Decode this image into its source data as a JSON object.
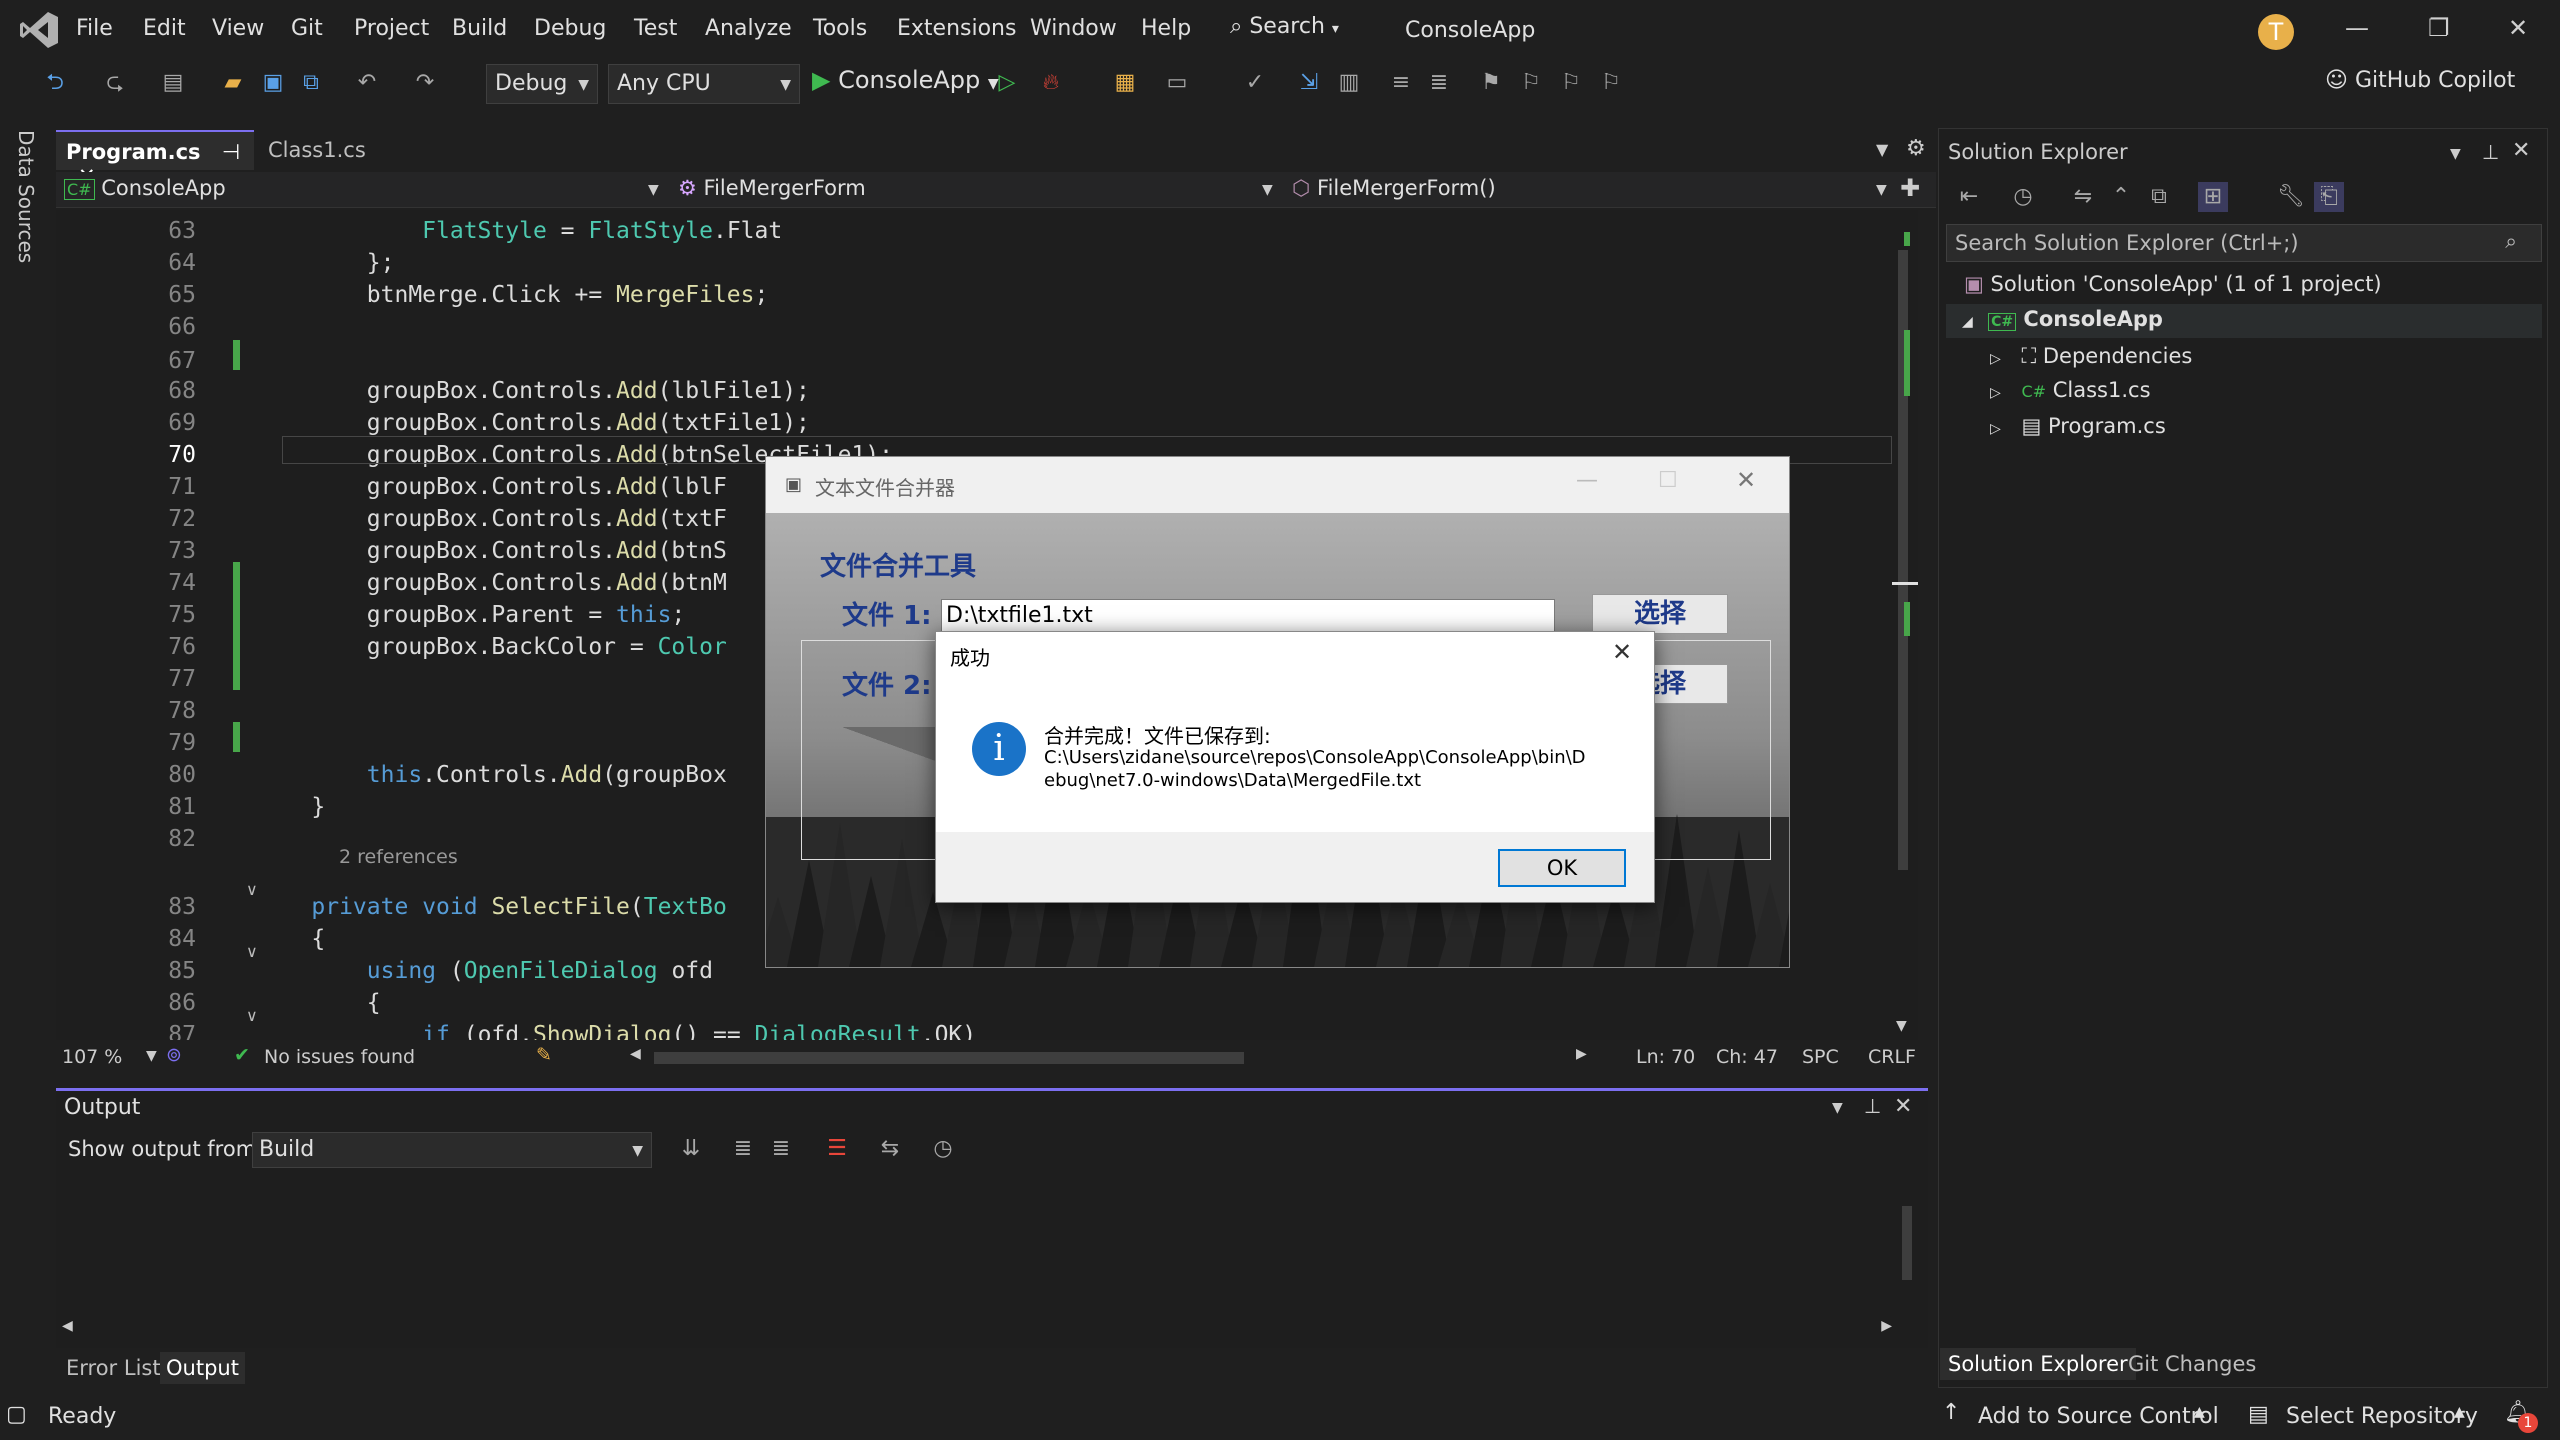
{
  "menu": [
    "File",
    "Edit",
    "View",
    "Git",
    "Project",
    "Build",
    "Debug",
    "Test",
    "Analyze",
    "Tools",
    "Extensions",
    "Window",
    "Help"
  ],
  "search_label": "Search",
  "app_name": "ConsoleApp",
  "avatar_initial": "T",
  "toolbar": {
    "config": "Debug",
    "platform": "Any CPU",
    "start_label": "ConsoleApp",
    "copilot": "GitHub Copilot"
  },
  "left_strip": "Data Sources",
  "tabs": [
    "Program.cs",
    "Class1.cs"
  ],
  "navbar": {
    "project": "ConsoleApp",
    "class": "FileMergerForm",
    "member": "FileMergerForm()"
  },
  "code": {
    "lines": [
      {
        "n": "63",
        "t": "            FlatStyle = FlatStyle.Flat"
      },
      {
        "n": "64",
        "t": "        };"
      },
      {
        "n": "65",
        "t": "        btnMerge.Click += MergeFiles;"
      },
      {
        "n": "66",
        "t": ""
      },
      {
        "n": "67",
        "t": ""
      },
      {
        "n": "68",
        "t": "        groupBox.Controls.Add(lblFile1);"
      },
      {
        "n": "69",
        "t": "        groupBox.Controls.Add(txtFile1);"
      },
      {
        "n": "70",
        "t": "        groupBox.Controls.Add(btnSelectFile1);"
      },
      {
        "n": "71",
        "t": "        groupBox.Controls.Add(lblF"
      },
      {
        "n": "72",
        "t": "        groupBox.Controls.Add(txtF"
      },
      {
        "n": "73",
        "t": "        groupBox.Controls.Add(btnS"
      },
      {
        "n": "74",
        "t": "        groupBox.Controls.Add(btnM"
      },
      {
        "n": "75",
        "t": "        groupBox.Parent = this;"
      },
      {
        "n": "76",
        "t": "        groupBox.BackColor = Color"
      },
      {
        "n": "77",
        "t": ""
      },
      {
        "n": "78",
        "t": ""
      },
      {
        "n": "79",
        "t": ""
      },
      {
        "n": "80",
        "t": "        this.Controls.Add(groupBox"
      },
      {
        "n": "81",
        "t": "    }"
      },
      {
        "n": "82",
        "t": ""
      },
      {
        "n": "83",
        "t": "    private void SelectFile(TextBo"
      },
      {
        "n": "84",
        "t": "    {"
      },
      {
        "n": "85",
        "t": "        using (OpenFileDialog ofd"
      },
      {
        "n": "86",
        "t": "        {"
      },
      {
        "n": "87",
        "t": "            if (ofd.ShowDialog() == DialogResult.OK)"
      }
    ],
    "refs_label": "2 references",
    "current_line": "70"
  },
  "editor_status": {
    "zoom": "107 %",
    "issues": "No issues found",
    "ln": "Ln: 70",
    "ch": "Ch: 47",
    "spc": "SPC",
    "eol": "CRLF"
  },
  "output": {
    "title": "Output",
    "show_from_label": "Show output from:",
    "source": "Build"
  },
  "bottom_tabs": [
    "Error List",
    "Output"
  ],
  "solution_explorer": {
    "title": "Solution Explorer",
    "search_placeholder": "Search Solution Explorer (Ctrl+;)",
    "solution": "Solution 'ConsoleApp' (1 of 1 project)",
    "project": "ConsoleApp",
    "items": [
      "Dependencies",
      "Class1.cs",
      "Program.cs"
    ],
    "tabs": [
      "Solution Explorer",
      "Git Changes"
    ]
  },
  "statusbar": {
    "ready": "Ready",
    "source_control": "Add to Source Control",
    "repository": "Select Repository",
    "notifications": "1"
  },
  "winform": {
    "title": "文本文件合并器",
    "header": "文件合并工具",
    "file1_label": "文件 1:",
    "file1_value": "D:\\txtfile1.txt",
    "file2_label": "文件 2:",
    "select_label": "选择"
  },
  "msgbox": {
    "title": "成功",
    "text": "合并完成！文件已保存到:",
    "path_line1": "C:\\Users\\zidane\\source\\repos\\ConsoleApp\\ConsoleApp\\bin\\D",
    "path_line2": "ebug\\net7.0-windows\\Data\\MergedFile.txt",
    "ok_label": "OK"
  },
  "colors": {
    "accent": "#7c6ff0",
    "change_bar": "#48a64a",
    "winform_header": "#1e3a8a",
    "info_icon": "#1a73c8"
  }
}
